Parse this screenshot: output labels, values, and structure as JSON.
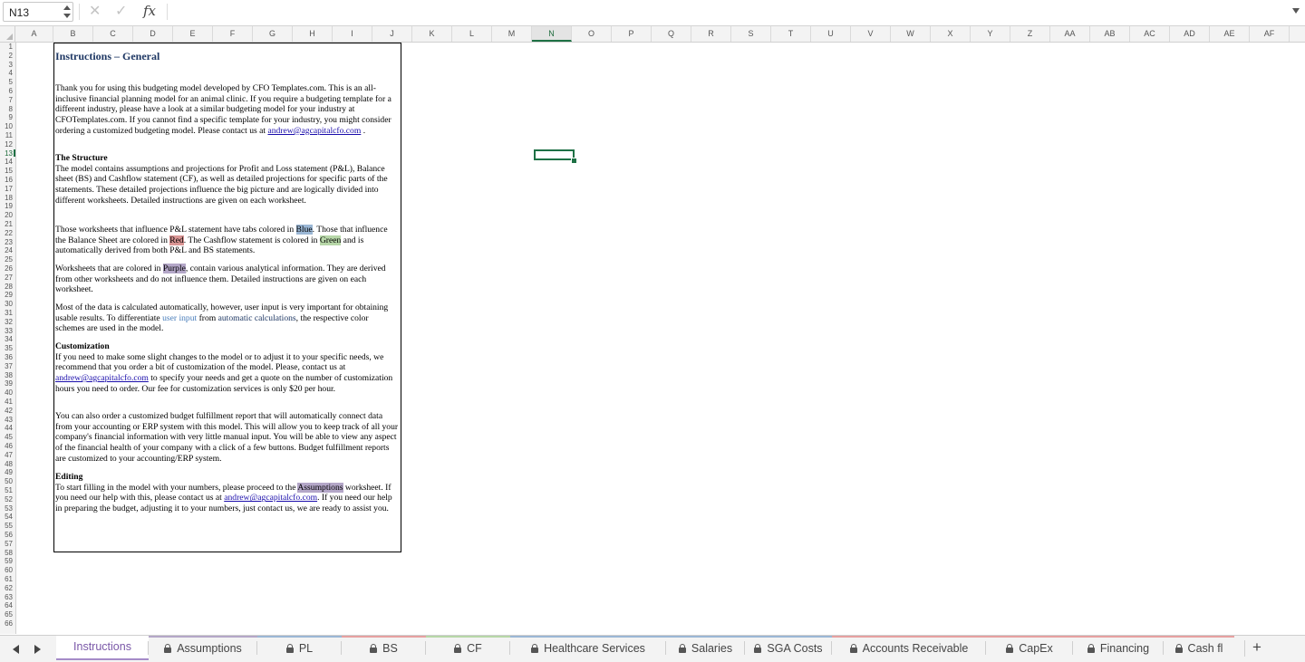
{
  "formula_bar": {
    "cell_ref": "N13",
    "fx": "fx",
    "formula": ""
  },
  "columns": [
    "A",
    "B",
    "C",
    "D",
    "E",
    "F",
    "G",
    "H",
    "I",
    "J",
    "K",
    "L",
    "M",
    "N",
    "O",
    "P",
    "Q",
    "R",
    "S",
    "T",
    "U",
    "V",
    "W",
    "X",
    "Y",
    "Z",
    "AA",
    "AB",
    "AC",
    "AD",
    "AE",
    "AF"
  ],
  "active_column": "N",
  "active_row": 13,
  "rows": [
    "1",
    "2",
    "3",
    "4",
    "5",
    "6",
    "7",
    "8",
    "9",
    "10",
    "11",
    "12",
    "13",
    "14",
    "15",
    "16",
    "17",
    "18",
    "19",
    "20",
    "21",
    "22",
    "23",
    "24",
    "25",
    "26",
    "27",
    "28",
    "29",
    "30",
    "31",
    "32",
    "33",
    "34",
    "35",
    "36",
    "37",
    "38",
    "39",
    "40",
    "41",
    "42",
    "43",
    "44",
    "45",
    "46",
    "47",
    "48",
    "49",
    "50",
    "51",
    "52",
    "53",
    "54",
    "55",
    "56",
    "57",
    "58",
    "59",
    "60",
    "61",
    "62",
    "63",
    "64",
    "65",
    "66"
  ],
  "textbox": {
    "title": "Instructions – General",
    "p1": "Thank you for using this budgeting model developed by CFO Templates.com. This is an all-inclusive financial planning model for an animal clinic. If you require a budgeting template for a different industry, please have a look at a similar budgeting model for your industry at CFOTemplates.com. If you cannot find a specific template for your industry, you might consider ordering a customized budgeting model. Please contact us at ",
    "email": "andrew@agcapitalcfo.com",
    "p1_end": " .",
    "structure_heading": "The Structure",
    "structure_text": "The model contains assumptions and projections for Profit and Loss statement (P&L), Balance sheet (BS) and Cashflow statement (CF), as well as detailed projections for specific parts of the statements. These detailed projections influence the big picture and are logically divided into different worksheets. Detailed instructions are given on each worksheet.",
    "colors_a": "Those worksheets that influence P&L statement have tabs colored in ",
    "blue": "Blue",
    "colors_b": ". Those that influence the Balance Sheet are colored in ",
    "red": "Red",
    "colors_c": ". The Cashflow statement is colored in ",
    "green": "Green",
    "colors_d": " and is automatically derived from both P&L and BS statements.",
    "purple_a": "Worksheets that are colored in ",
    "purple": "Purple",
    "purple_b": ", contain various analytical information. They are derived from other worksheets and do not influence them. Detailed instructions are given on each worksheet.",
    "data_a": "Most of the data is calculated automatically, however, user input is very important for obtaining usable results. To differentiate ",
    "user_input": "user input",
    "data_b": " from ",
    "auto_calc": "automatic calculations",
    "data_c": ", the respective color schemes are used in the model.",
    "custom_heading": "Customization",
    "custom_a": "If you need to make some slight changes to the model or to adjust it to your specific needs, we recommend that you order a bit of customization of the model. Please, contact us at ",
    "custom_b": " to specify your needs and get a quote on the number of customization hours you need to order. Our fee for customization services is only $20 per hour.",
    "report_text": "You can also order a customized budget fulfillment report that will automatically connect data from your accounting or ERP system with this model. This will allow you to keep track of all your company's financial information with very little manual input. You will be able to view any aspect of the financial health of your company with a click of a few buttons. Budget fulfillment reports are customized to your accounting/ERP system.",
    "edit_heading": "Editing",
    "edit_a": "To start filling in the model with your numbers, please proceed to the ",
    "assumptions": "Assumptions",
    "edit_b": " worksheet. If you need our help with this, please contact us at ",
    "edit_c": ". If you need our help in preparing the budget, adjusting it to your numbers, just contact us, we are ready to assist you."
  },
  "sheet_tabs": [
    {
      "label": "Instructions",
      "locked": false,
      "active": true,
      "color": "#a58bc8"
    },
    {
      "label": "Assumptions",
      "locked": true,
      "active": false,
      "color": "#b4a7c8"
    },
    {
      "label": "PL",
      "locked": true,
      "active": false,
      "color": "#9bb7d5"
    },
    {
      "label": "BS",
      "locked": true,
      "active": false,
      "color": "#e6a0a0"
    },
    {
      "label": "CF",
      "locked": true,
      "active": false,
      "color": "#b7d7a8"
    },
    {
      "label": "Healthcare Services",
      "locked": true,
      "active": false,
      "color": "#9bb7d5"
    },
    {
      "label": "Salaries",
      "locked": true,
      "active": false,
      "color": "#9bb7d5"
    },
    {
      "label": "SGA Costs",
      "locked": true,
      "active": false,
      "color": "#9bb7d5"
    },
    {
      "label": "Accounts Receivable",
      "locked": true,
      "active": false,
      "color": "#e6a0a0"
    },
    {
      "label": "CapEx",
      "locked": true,
      "active": false,
      "color": "#e6a0a0"
    },
    {
      "label": "Financing",
      "locked": true,
      "active": false,
      "color": "#e6a0a0"
    },
    {
      "label": "Cash fl",
      "locked": true,
      "active": false,
      "color": "#e6a0a0"
    }
  ],
  "add_sheet": "+",
  "colors": {
    "accent": "#1e7145",
    "active_tab": "#7a58a8"
  }
}
